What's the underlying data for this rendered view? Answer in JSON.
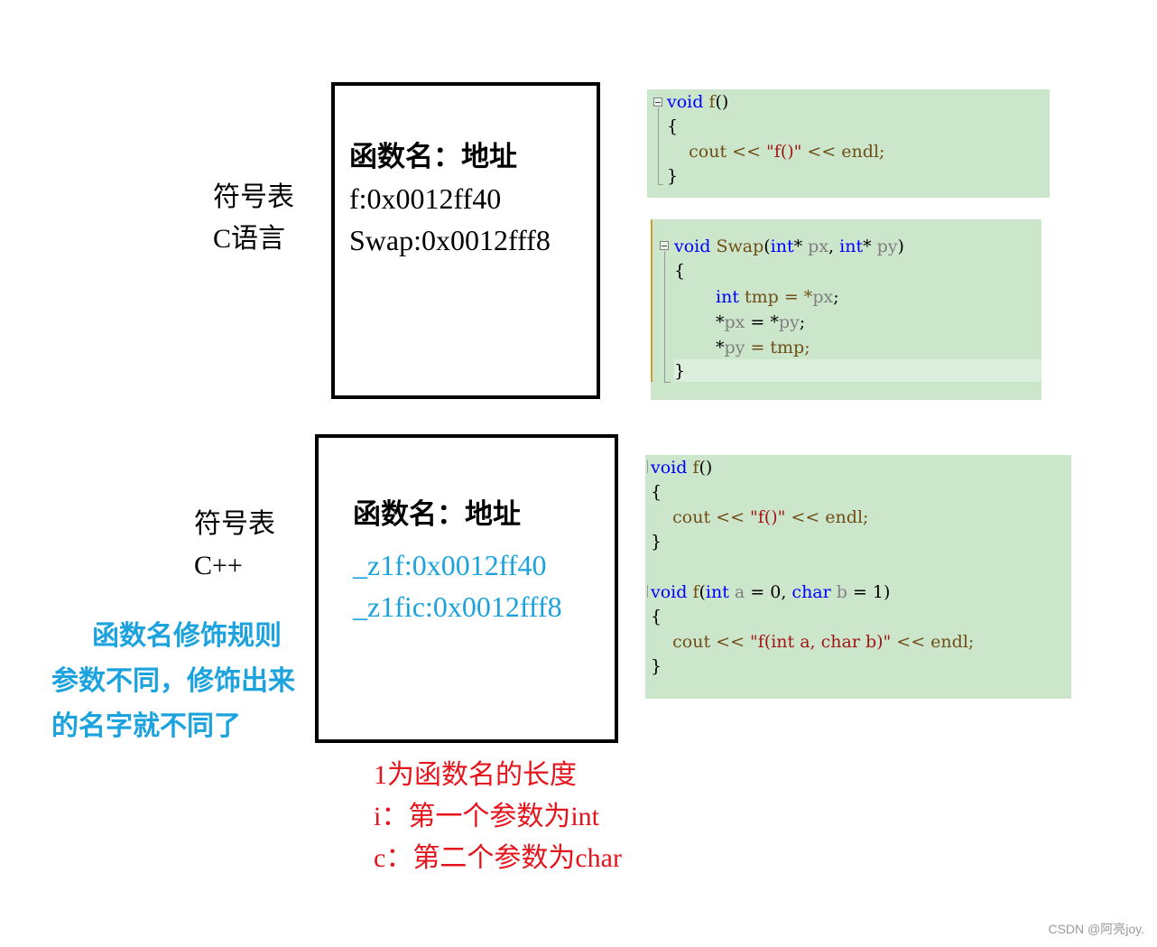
{
  "c_section": {
    "label_line1": "符号表",
    "label_line2": "C语言",
    "box": {
      "header": "函数名：地址",
      "entries": [
        "f:0x0012ff40",
        "Swap:0x0012fff8"
      ]
    },
    "code_f": {
      "lines": [
        {
          "kw": "void",
          "name": " f",
          "rest": "()"
        },
        {
          "text": "{"
        },
        {
          "text": "    cout << ",
          "str": "\"f()\"",
          "tail": " << endl;"
        },
        {
          "text": "}"
        }
      ]
    },
    "code_swap": {
      "sig_kw": "void",
      "sig_name": " Swap",
      "sig_open": "(",
      "sig_type1": "int",
      "sig_star1": "* ",
      "sig_p1": "px",
      "sig_comma": ", ",
      "sig_type2": "int",
      "sig_star2": "* ",
      "sig_p2": "py",
      "sig_close": ")",
      "open_brace": "{",
      "l1_kw": "int",
      "l1_rest": " tmp = *",
      "l1_p": "px",
      "l1_end": ";",
      "l2_star": "*",
      "l2_p1": "px",
      "l2_mid": " = *",
      "l2_p2": "py",
      "l2_end": ";",
      "l3_star": "*",
      "l3_p": "py",
      "l3_rest": " = tmp;",
      "close_brace": "}"
    }
  },
  "cpp_section": {
    "label_line1": "符号表",
    "label_line2": "C++",
    "box": {
      "header": "函数名：地址",
      "entries": [
        "_z1f:0x0012ff40",
        "_z1fic:0x0012fff8"
      ]
    },
    "note_blue": [
      "函数名修饰规则",
      "参数不同，修饰出来",
      "的名字就不同了"
    ],
    "note_red": [
      "1为函数名的长度",
      "i：第一个参数为int",
      "c：第二个参数为char"
    ],
    "code_overload": {
      "f1_kw": "void",
      "f1_name": " f",
      "f1_rest": "()",
      "f1_open": "{",
      "f1_body_pre": "    cout << ",
      "f1_body_str": "\"f()\"",
      "f1_body_post": " << endl;",
      "f1_close": "}",
      "f2_kw": "void",
      "f2_name": " f",
      "f2_open_paren": "(",
      "f2_t1": "int",
      "f2_p1": " a",
      "f2_eq1": " = 0, ",
      "f2_t2": "char",
      "f2_p2": " b",
      "f2_eq2": " = 1)",
      "f2_open": "{",
      "f2_body_pre": "    cout << ",
      "f2_body_str": "\"f(int a, char b)\"",
      "f2_body_post": " << endl;",
      "f2_close": "}"
    }
  },
  "watermark": "CSDN @阿亮joy."
}
